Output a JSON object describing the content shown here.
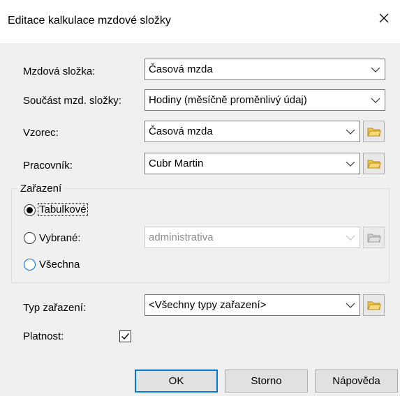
{
  "window": {
    "title": "Editace kalkulace mzdové složky",
    "close_icon": "close-icon"
  },
  "form": {
    "mzdova_slozka": {
      "label": "Mzdová složka:",
      "value": "Časová mzda"
    },
    "soucast": {
      "label": "Součást mzd. složky:",
      "value": "Hodiny (měsíčně proměnlivý údaj)"
    },
    "vzorec": {
      "label": "Vzorec:",
      "value": "Časová mzda"
    },
    "pracovnik": {
      "label": "Pracovník:",
      "value": "Cubr Martin"
    }
  },
  "zarazeni": {
    "legend": "Zařazení",
    "options": [
      {
        "label": "Tabulkové",
        "checked": true
      },
      {
        "label": "Vybrané:",
        "checked": false
      },
      {
        "label": "Všechna",
        "checked": false
      }
    ],
    "vybrane_value": "administrativa"
  },
  "typ_zarazeni": {
    "label": "Typ zařazení:",
    "value": "<Všechny typy zařazení>"
  },
  "platnost": {
    "label": "Platnost:",
    "checked": true
  },
  "buttons": {
    "ok": "OK",
    "storno": "Storno",
    "napoveda": "Nápověda"
  },
  "colors": {
    "accent": "#0078d7",
    "folder": "#f2c94c"
  }
}
